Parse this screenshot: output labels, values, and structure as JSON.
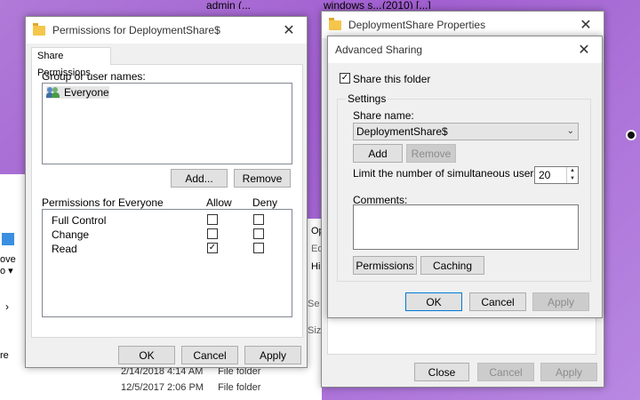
{
  "background": {
    "top_texts": [
      "admin (...",
      "windows s...",
      "(2010) [...]"
    ],
    "left_explorer": {
      "move_label": "ove",
      "to_label": "o ▾",
      "arrow": "›",
      "re_label": "re"
    },
    "mid_explorer": [
      "Op",
      "Ed",
      "Hi",
      "Se",
      "Siz"
    ],
    "files": [
      {
        "date": "2/14/2018 4:14 AM",
        "type": "File folder"
      },
      {
        "date": "12/5/2017 2:06 PM",
        "type": "File folder"
      }
    ]
  },
  "permissions_dialog": {
    "title": "Permissions for DeploymentShare$",
    "tab": "Share Permissions",
    "group_label": "Group or user names:",
    "users": [
      "Everyone"
    ],
    "add_button": "Add...",
    "remove_button": "Remove",
    "perm_header": "Permissions for Everyone",
    "allow_header": "Allow",
    "deny_header": "Deny",
    "permissions": [
      {
        "name": "Full Control",
        "allow": false,
        "deny": false
      },
      {
        "name": "Change",
        "allow": false,
        "deny": false
      },
      {
        "name": "Read",
        "allow": true,
        "deny": false
      }
    ],
    "ok": "OK",
    "cancel": "Cancel",
    "apply": "Apply"
  },
  "properties_dialog": {
    "title": "DeploymentShare Properties",
    "close": "Close",
    "cancel": "Cancel",
    "apply": "Apply"
  },
  "advanced_sharing": {
    "title": "Advanced Sharing",
    "share_checkbox_label": "Share this folder",
    "share_checked": true,
    "settings_label": "Settings",
    "share_name_label": "Share name:",
    "share_name_value": "DeploymentShare$",
    "add": "Add",
    "remove": "Remove",
    "limit_label": "Limit the number of simultaneous users to:",
    "limit_value": "20",
    "comments_label": "Comments:",
    "permissions_button": "Permissions",
    "caching_button": "Caching",
    "ok": "OK",
    "cancel": "Cancel",
    "apply": "Apply"
  },
  "icons": {
    "folder": "folder-icon",
    "users": "users-group-icon",
    "close": "close-icon"
  }
}
